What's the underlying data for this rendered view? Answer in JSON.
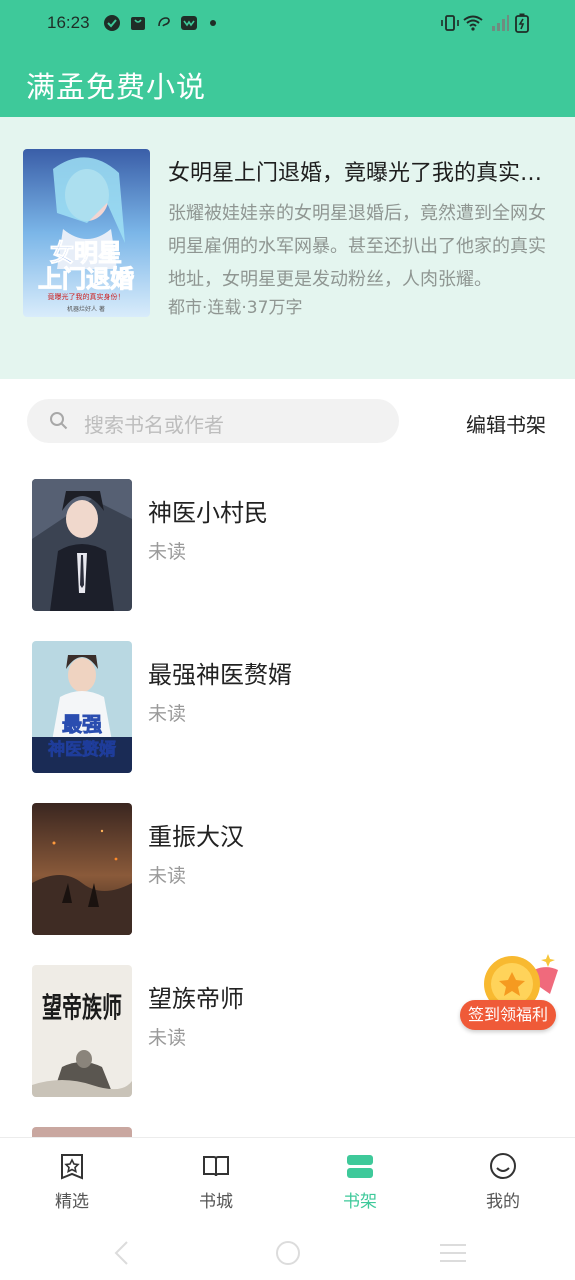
{
  "status_bar": {
    "time": "16:23"
  },
  "app_bar": {
    "title": "满孟免费小说"
  },
  "featured": {
    "title": "女明星上门退婚，竟曝光了我的真实身份",
    "description": "张耀被娃娃亲的女明星退婚后，竟然遭到全网女明星雇佣的水军网暴。甚至还扒出了他家的真实地址，女明星更是发动粉丝，人肉张耀。",
    "meta": "都市·连载·37万字",
    "cover_text_line1": "女明星",
    "cover_text_line2": "上门退婚",
    "cover_subtitle": "竟曝光了我的真实身份！",
    "cover_author": "机器烂好人 著"
  },
  "search": {
    "placeholder": "搜索书名或作者"
  },
  "edit_shelf_label": "编辑书架",
  "books": [
    {
      "title": "神医小村民",
      "status": "未读"
    },
    {
      "title": "最强神医赘婿",
      "status": "未读",
      "cover_text_line1": "最强",
      "cover_text_line2": "神医赘婿"
    },
    {
      "title": "重振大汉",
      "status": "未读"
    },
    {
      "title": "望族帝师",
      "status": "未读",
      "cover_text": "望帝族师"
    }
  ],
  "reward": {
    "label": "签到领福利"
  },
  "bottom_nav": [
    {
      "label": "精选",
      "icon": "star-book-icon"
    },
    {
      "label": "书城",
      "icon": "open-book-icon"
    },
    {
      "label": "书架",
      "icon": "shelf-icon",
      "active": true
    },
    {
      "label": "我的",
      "icon": "smiley-icon"
    }
  ],
  "colors": {
    "accent": "#3ec99a",
    "featured_bg": "#e4f5ef",
    "reward": "#ef5a38"
  }
}
